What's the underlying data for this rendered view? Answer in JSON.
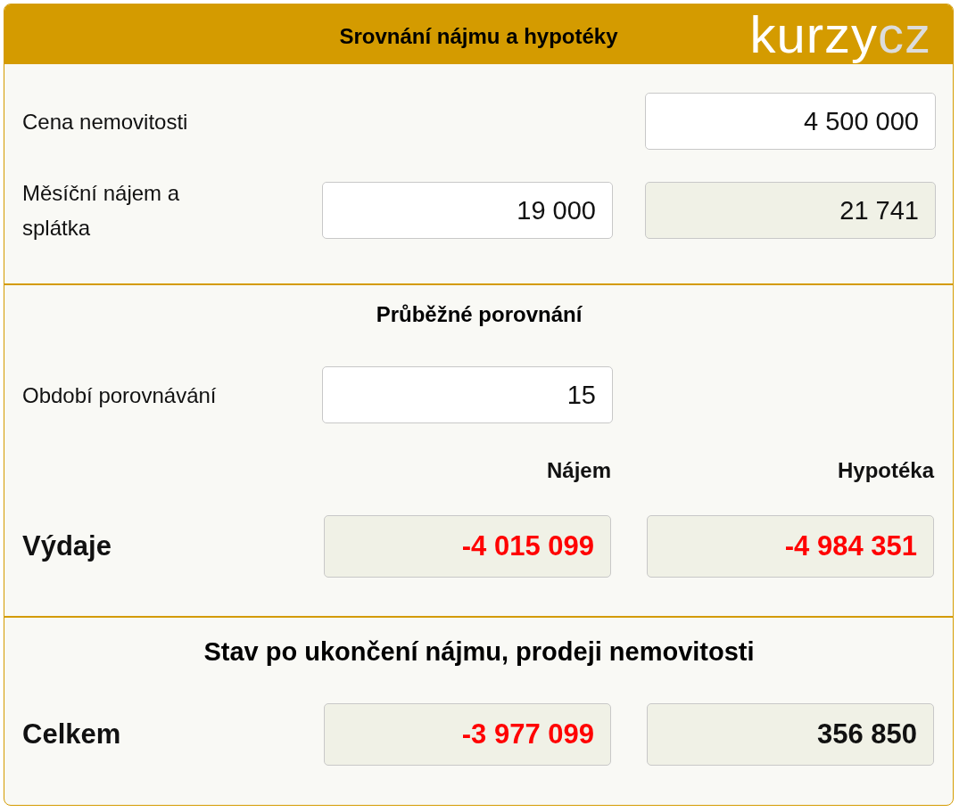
{
  "header": {
    "title": "Srovnání nájmu a hypotéky",
    "logo": {
      "main": "kurzy",
      "suffix": "cz"
    }
  },
  "parameters": [
    {
      "label": "Cena nemovitosti",
      "mortgage": {
        "kind": "input",
        "value": "4 500 000"
      }
    },
    {
      "label": "Měsíční nájem a splátka",
      "rent": {
        "kind": "input",
        "value": "19 000"
      },
      "mortgage": {
        "kind": "readonly",
        "value": "21 741"
      }
    }
  ],
  "running_comparison": {
    "title": "Průběžné porovnání",
    "period": {
      "label": "Období porovnávání",
      "value": "15"
    },
    "columns": [
      "Nájem",
      "Hypotéka"
    ],
    "rows": [
      {
        "label": "Výdaje",
        "rent": {
          "value": "-4 015 099",
          "negative": true
        },
        "mortgage": {
          "value": "-4 984 351",
          "negative": true
        }
      }
    ]
  },
  "final_state": {
    "title": "Stav po ukončení nájmu, prodeji nemovitosti",
    "rows": [
      {
        "label": "Celkem",
        "rent": {
          "value": "-3 977 099",
          "negative": true
        },
        "mortgage": {
          "value": "356 850",
          "negative": false
        }
      }
    ]
  }
}
